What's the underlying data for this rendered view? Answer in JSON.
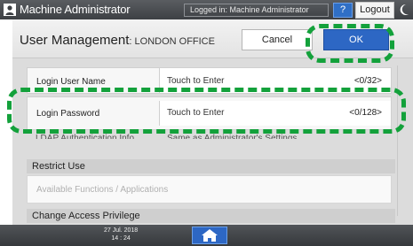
{
  "header": {
    "title": "Machine Administrator",
    "login_status": "Logged in: Machine Administrator",
    "help_label": "?",
    "logout_label": "Logout"
  },
  "screen": {
    "title": "User Management",
    "subtitle": ": LONDON OFFICE",
    "cancel_label": "Cancel",
    "ok_label": "OK"
  },
  "rows": [
    {
      "label": "Login User Name",
      "value": "Touch to Enter",
      "count": "<0/32>"
    },
    {
      "label": "Login Password",
      "value": "Touch to Enter",
      "count": "<0/128>"
    }
  ],
  "ldap_row": {
    "label": "LDAP Authentication Info",
    "value": "Same as Administrator's Settings"
  },
  "sections": {
    "restrict_use": "Restrict Use",
    "restrict_item": "Available Functions / Applications",
    "change_access": "Change Access Privilege"
  },
  "footer": {
    "date": "27 Jul. 2018",
    "time": "14 : 24"
  },
  "colors": {
    "accent_blue": "#2d67c4",
    "callout_green": "#13a13b",
    "header_dark": "#45484c"
  },
  "icons": {
    "user": "user-icon",
    "moon": "moon-icon",
    "home": "home-icon"
  }
}
